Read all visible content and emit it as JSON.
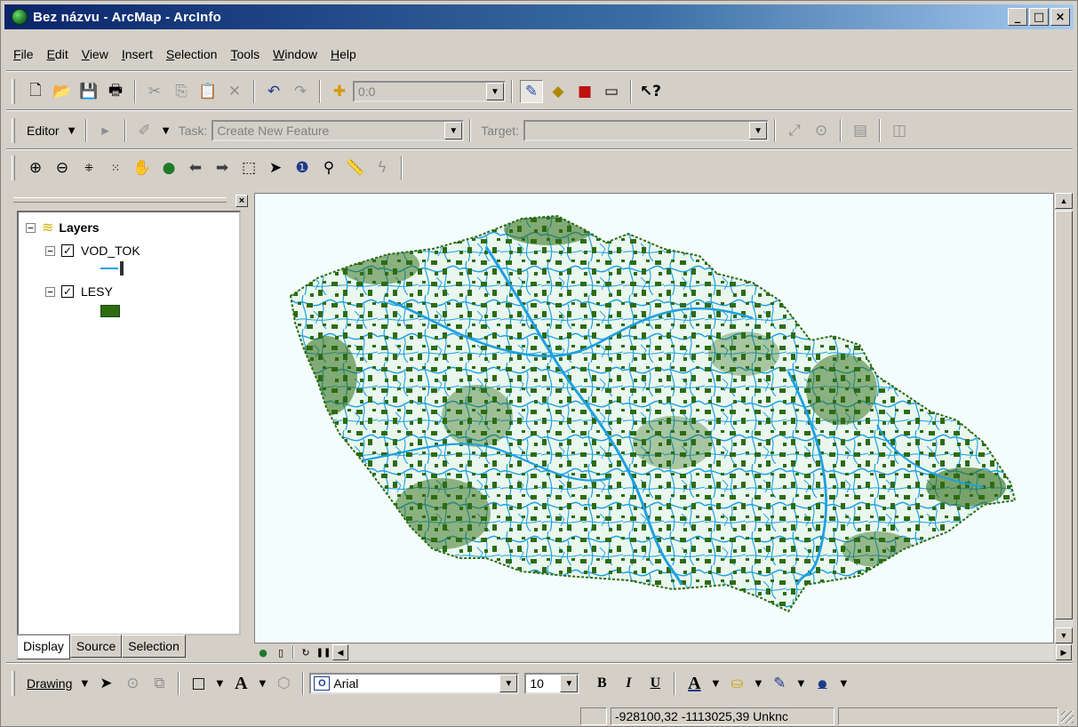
{
  "window": {
    "title": "Bez názvu - ArcMap - ArcInfo",
    "min": "_",
    "max": "□",
    "close": "×"
  },
  "menu": [
    "File",
    "Edit",
    "View",
    "Insert",
    "Selection",
    "Tools",
    "Window",
    "Help"
  ],
  "standard_toolbar": {
    "scale_value": "0:0"
  },
  "editor_toolbar": {
    "editor_label": "Editor",
    "task_label": "Task:",
    "task_value": "Create New Feature",
    "target_label": "Target:",
    "target_value": ""
  },
  "toc": {
    "root": "Layers",
    "layers": [
      {
        "name": "VOD_TOK",
        "checked": true,
        "color": "#1fa0e0"
      },
      {
        "name": "LESY",
        "checked": true,
        "color": "#2e6b12"
      }
    ],
    "tabs": [
      "Display",
      "Source",
      "Selection"
    ]
  },
  "map": {
    "background": "#f4fdfd",
    "rivers_color": "#1fa0e0",
    "forest_color": "#2e6b12"
  },
  "drawing_toolbar": {
    "drawing_label": "Drawing",
    "font_name": "Arial",
    "font_size": "10"
  },
  "status": {
    "coordinates": "-928100,32  -1113025,39 Unknc"
  }
}
